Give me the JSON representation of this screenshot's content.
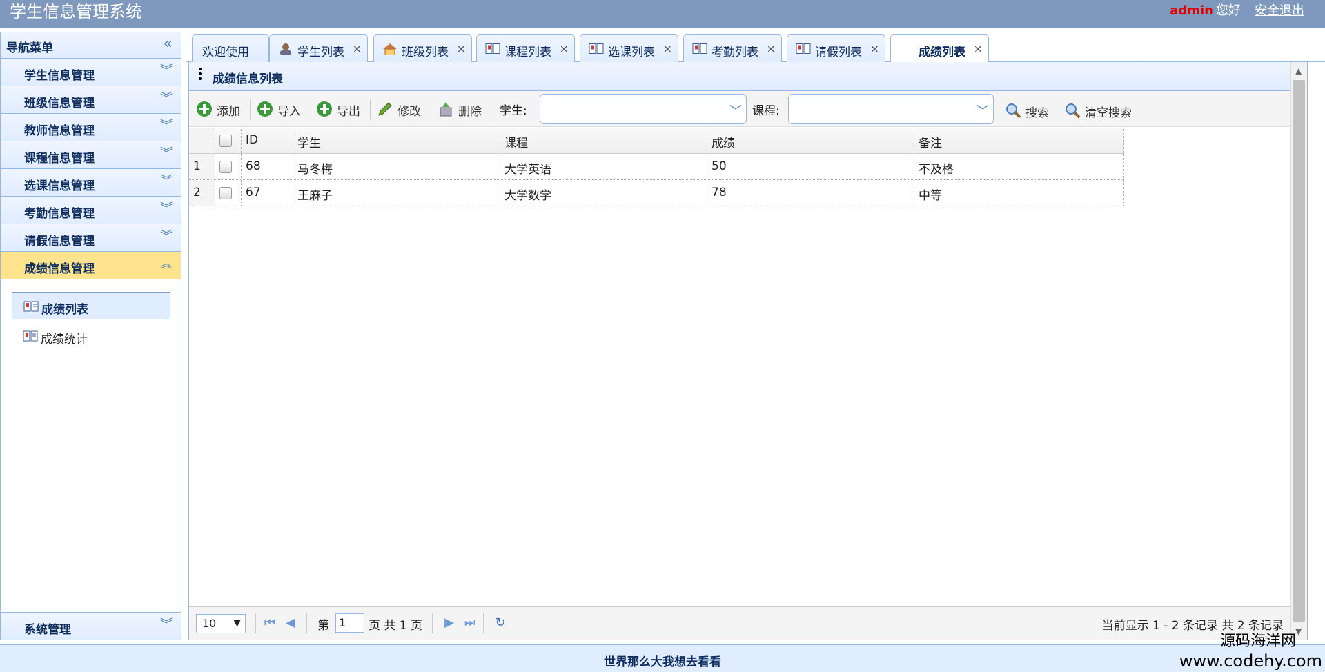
{
  "header": {
    "title": "学生信息管理系统",
    "user": "admin",
    "greeting": "您好",
    "logout": "安全退出"
  },
  "sidebar": {
    "title": "导航菜单",
    "items": [
      {
        "label": "学生信息管理"
      },
      {
        "label": "班级信息管理"
      },
      {
        "label": "教师信息管理"
      },
      {
        "label": "课程信息管理"
      },
      {
        "label": "选课信息管理"
      },
      {
        "label": "考勤信息管理"
      },
      {
        "label": "请假信息管理"
      },
      {
        "label": "成绩信息管理"
      }
    ],
    "submenu": [
      {
        "label": "成绩列表"
      },
      {
        "label": "成绩统计"
      }
    ],
    "system": "系统管理"
  },
  "tabs": [
    {
      "label": "欢迎使用"
    },
    {
      "label": "学生列表"
    },
    {
      "label": "班级列表"
    },
    {
      "label": "课程列表"
    },
    {
      "label": "选课列表"
    },
    {
      "label": "考勤列表"
    },
    {
      "label": "请假列表"
    },
    {
      "label": "成绩列表"
    }
  ],
  "tab_close": "×",
  "panel": {
    "title": "成绩信息列表"
  },
  "toolbar": {
    "add": "添加",
    "import": "导入",
    "export": "导出",
    "edit": "修改",
    "delete": "删除",
    "student_label": "学生:",
    "course_label": "课程:",
    "search": "搜索",
    "clear": "清空搜索"
  },
  "grid": {
    "columns": {
      "id": "ID",
      "student": "学生",
      "course": "课程",
      "score": "成绩",
      "remark": "备注"
    },
    "rows": [
      {
        "num": "1",
        "id": "68",
        "student": "马冬梅",
        "course": "大学英语",
        "score": "50",
        "remark": "不及格"
      },
      {
        "num": "2",
        "id": "67",
        "student": "王麻子",
        "course": "大学数学",
        "score": "78",
        "remark": "中等"
      }
    ]
  },
  "pager": {
    "page_size": "10",
    "page_prefix": "第",
    "page_value": "1",
    "page_suffix": "页 共 1 页",
    "info": "当前显示 1 - 2 条记录 共 2 条记录"
  },
  "footer": {
    "text": "世界那么大我想去看看"
  },
  "watermark": {
    "line1": "源码海洋网",
    "line2": "www.codehy.com"
  },
  "colors": {
    "header_bg": "#7f99be",
    "border": "#95b8e7",
    "active_menu": "#ffe48d",
    "user": "#e00000"
  }
}
